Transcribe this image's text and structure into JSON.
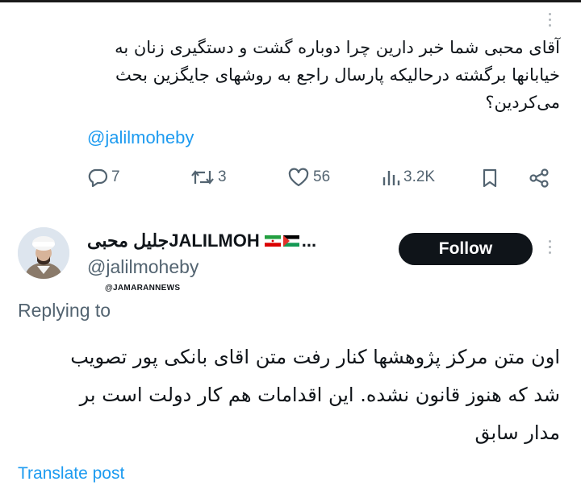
{
  "quoted_tweet": {
    "text": "آقای محبی شما خبر دارین چرا دوباره گشت و دستگیری زنان به خیابانها برگشته درحالیکه پارسال راجع به روشهای جایگزین بحث می‌کردین؟",
    "mention": "@jalilmoheby",
    "actions": {
      "replies": "7",
      "reposts": "3",
      "likes": "56",
      "views": "3.2K"
    }
  },
  "author": {
    "display_name": "جلیل محبیJALILMOH",
    "flags_text": "...",
    "handle": "@jalilmoheby",
    "follow_label": "Follow"
  },
  "watermark": "@JAMARANNEWS",
  "reply": {
    "replying_to": "Replying to",
    "text": "اون متن مرکز پژوهشها کنار رفت متن اقای بانکی پور تصویب شد که هنوز قانون نشده. این اقدامات هم کار دولت است بر مدار سابق",
    "translate_label": "Translate post"
  },
  "colors": {
    "link": "#1d9bf0",
    "muted": "#536471",
    "button": "#0f1419"
  },
  "icons": [
    "more-icon",
    "reply-icon",
    "repost-icon",
    "like-icon",
    "views-icon",
    "bookmark-icon",
    "share-icon",
    "palestine-flag-icon",
    "iran-flag-icon"
  ]
}
